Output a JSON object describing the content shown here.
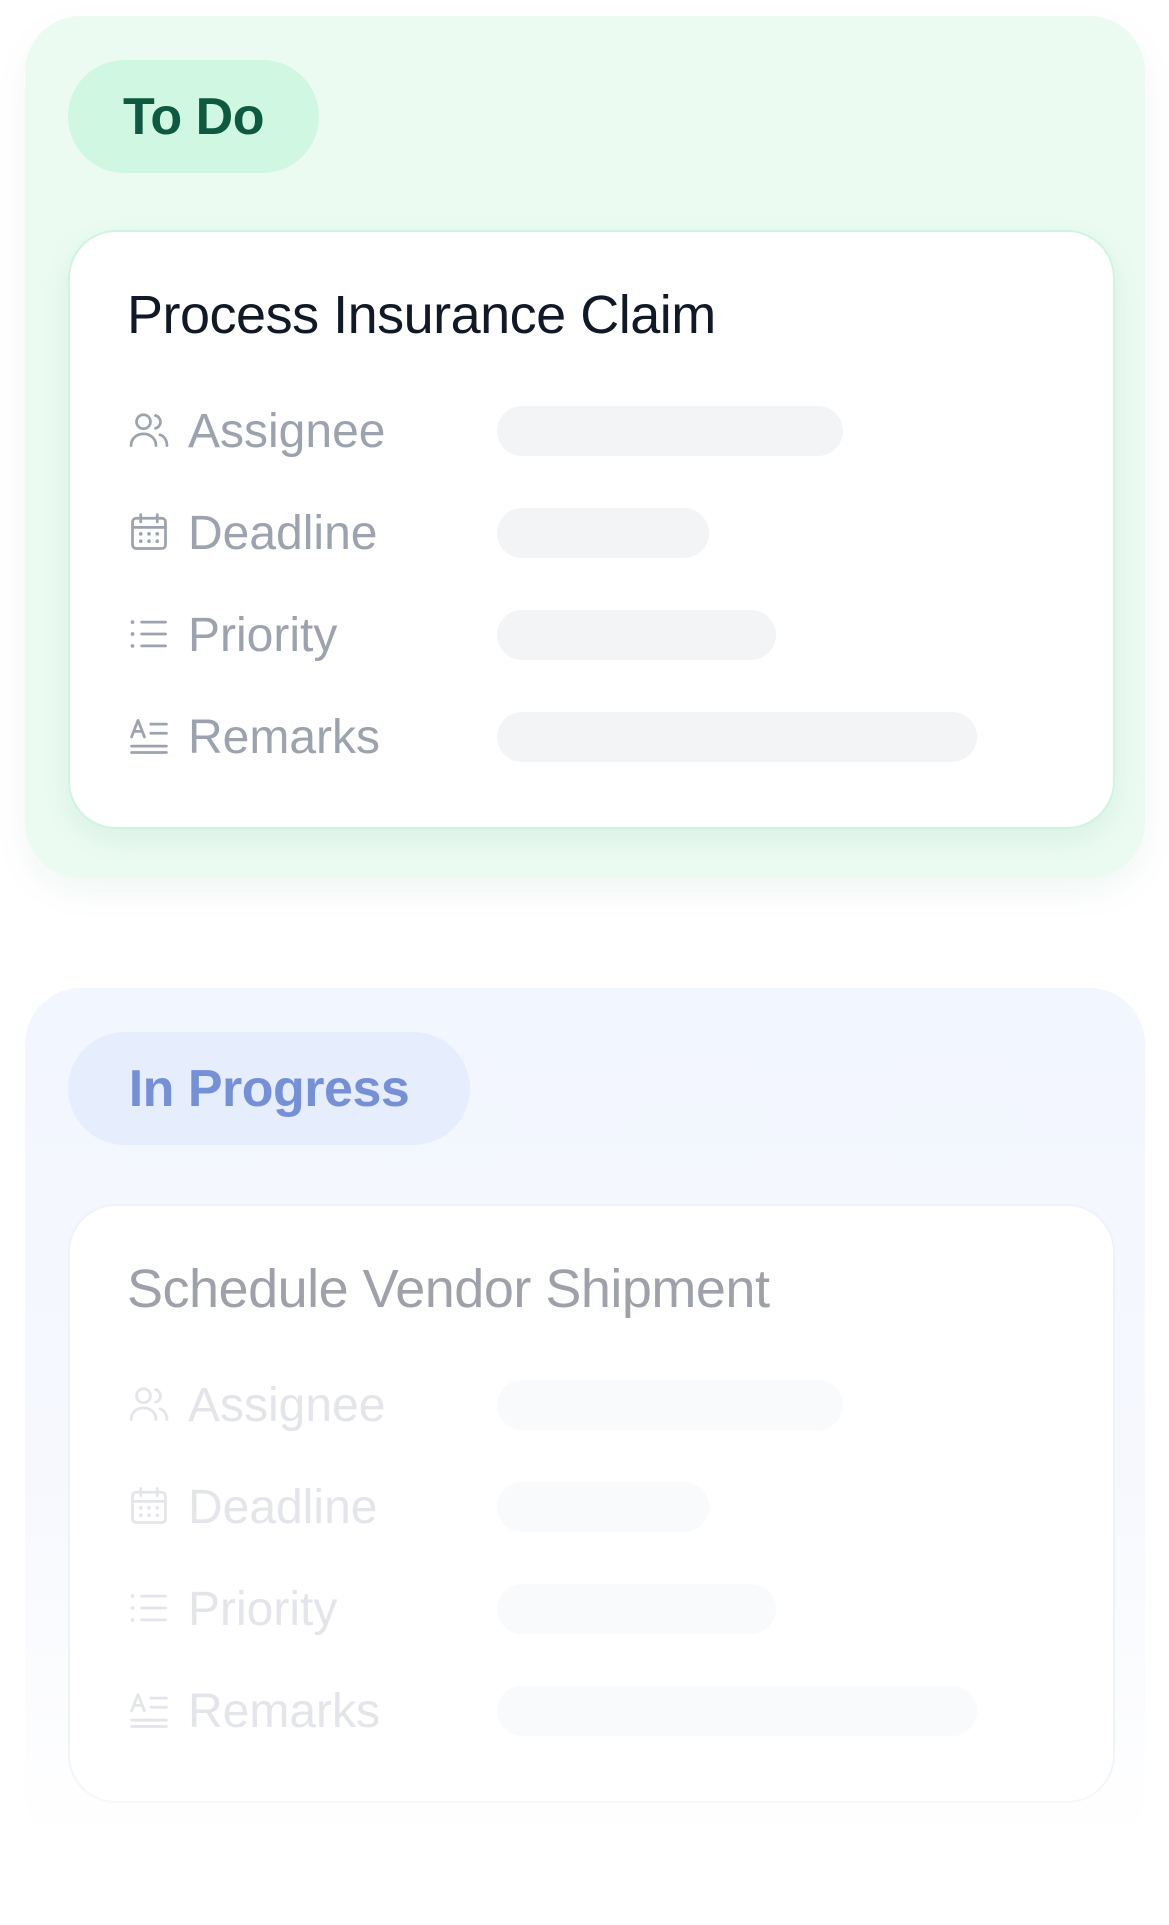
{
  "columns": [
    {
      "title": "To Do",
      "card": {
        "title": "Process Insurance Claim",
        "fields": [
          {
            "label": "Assignee",
            "icon": "users-icon"
          },
          {
            "label": "Deadline",
            "icon": "calendar-icon"
          },
          {
            "label": "Priority",
            "icon": "list-icon"
          },
          {
            "label": "Remarks",
            "icon": "text-align-icon"
          }
        ]
      }
    },
    {
      "title": "In Progress",
      "card": {
        "title": "Schedule Vendor Shipment",
        "fields": [
          {
            "label": "Assignee",
            "icon": "users-icon"
          },
          {
            "label": "Deadline",
            "icon": "calendar-icon"
          },
          {
            "label": "Priority",
            "icon": "list-icon"
          },
          {
            "label": "Remarks",
            "icon": "text-align-icon"
          }
        ]
      }
    }
  ],
  "colors": {
    "todo_column_bg": "#ebfbf2",
    "todo_pill_bg": "#cff7e1",
    "todo_pill_text": "#0d5a40",
    "progress_column_bg": "#f2f6fe",
    "progress_pill_bg": "#e6eefd",
    "progress_pill_text": "#7690d8",
    "placeholder_bar": "#f3f4f6",
    "label_text": "#9ca3af"
  }
}
